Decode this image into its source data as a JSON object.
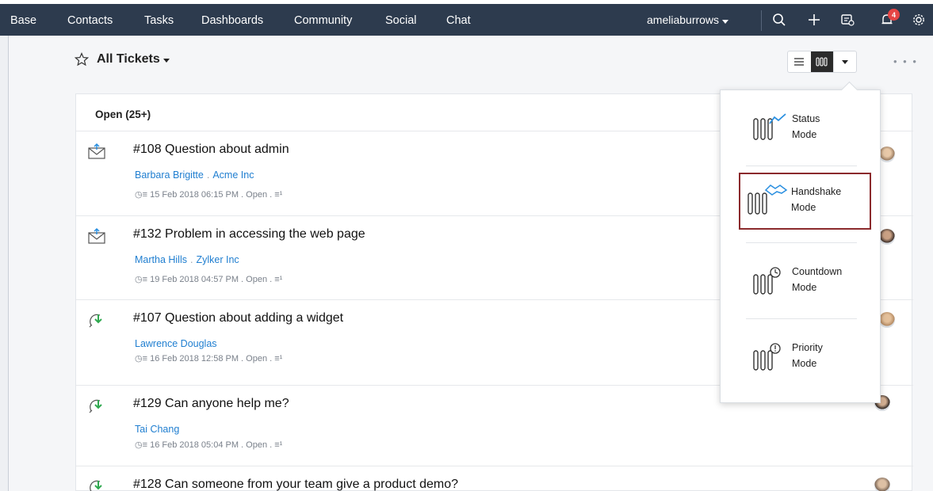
{
  "topbar": {
    "nav": [
      "Base",
      "Contacts",
      "Tasks",
      "Dashboards",
      "Community",
      "Social",
      "Chat"
    ],
    "user": "ameliaburrows",
    "notification_count": "4",
    "icons": [
      "search-icon",
      "plus-icon",
      "compose-icon",
      "bell-icon",
      "gear-icon"
    ]
  },
  "header": {
    "title": "All Tickets",
    "more": "• • •"
  },
  "list": {
    "group_title": "Open (25+)",
    "tickets": [
      {
        "subject": "#108 Question about admin",
        "contact": "Barbara Brigitte",
        "account": "Acme Inc",
        "meta": "15 Feb 2018 06:15 PM  .  Open  .",
        "channel": "email"
      },
      {
        "subject": "#132 Problem in accessing the web page",
        "contact": "Martha Hills",
        "account": "Zylker Inc",
        "meta": "19 Feb 2018 04:57 PM  .  Open  .",
        "channel": "email"
      },
      {
        "subject": "#107 Question about adding a widget",
        "contact": "Lawrence Douglas",
        "account": "",
        "meta": "16 Feb 2018 12:58 PM  .  Open  .",
        "channel": "forum"
      },
      {
        "subject": "#129 Can anyone help me?",
        "contact": "Tai Chang",
        "account": "",
        "meta": "16 Feb 2018 05:04 PM  .  Open  .",
        "channel": "forum"
      },
      {
        "subject": "#128 Can someone from your team give a  product demo?",
        "contact": "",
        "account": "",
        "meta": "",
        "channel": "forum"
      }
    ]
  },
  "view_modes": [
    {
      "line1": "Status",
      "line2": "Mode"
    },
    {
      "line1": "Handshake",
      "line2": "Mode"
    },
    {
      "line1": "Countdown",
      "line2": "Mode"
    },
    {
      "line1": "Priority",
      "line2": "Mode"
    }
  ],
  "colors": {
    "topbar": "#2d3b4e",
    "link": "#1f7ed0",
    "selected_border": "#8b2a2c",
    "accent_blue": "#2a8fe0",
    "forum_green": "#2fa84f"
  }
}
